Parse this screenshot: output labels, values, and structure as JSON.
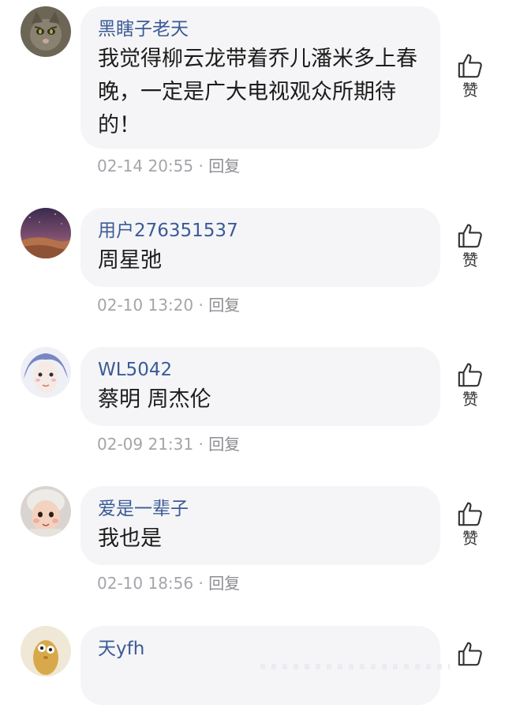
{
  "comments": [
    {
      "username": "黑瞎子老天",
      "text": "我觉得柳云龙带着乔儿潘米多上春晚，一定是广大电视观众所期待的！",
      "time": "02-14 20:55",
      "separator": "·",
      "reply": "回复",
      "like": "赞",
      "avatar": "cat-avatar-icon"
    },
    {
      "username": "用户276351537",
      "text": "周星弛",
      "time": "02-10 13:20",
      "separator": "·",
      "reply": "回复",
      "like": "赞",
      "avatar": "desert-night-avatar-icon"
    },
    {
      "username": "WL5042",
      "text": "蔡明 周杰伦",
      "time": "02-09 21:31",
      "separator": "·",
      "reply": "回复",
      "like": "赞",
      "avatar": "illustrated-face-avatar-icon"
    },
    {
      "username": "爱是一辈子",
      "text": "我也是",
      "time": "02-10 18:56",
      "separator": "·",
      "reply": "回复",
      "like": "赞",
      "avatar": "baby-avatar-icon"
    },
    {
      "username": "天yfh",
      "text": "",
      "time": "",
      "separator": "",
      "reply": "",
      "like": "",
      "avatar": "cartoon-avatar-icon"
    }
  ],
  "colors": {
    "username": "#3b5b96",
    "bubble": "#f5f5f7",
    "meta": "#a5a5aa"
  }
}
